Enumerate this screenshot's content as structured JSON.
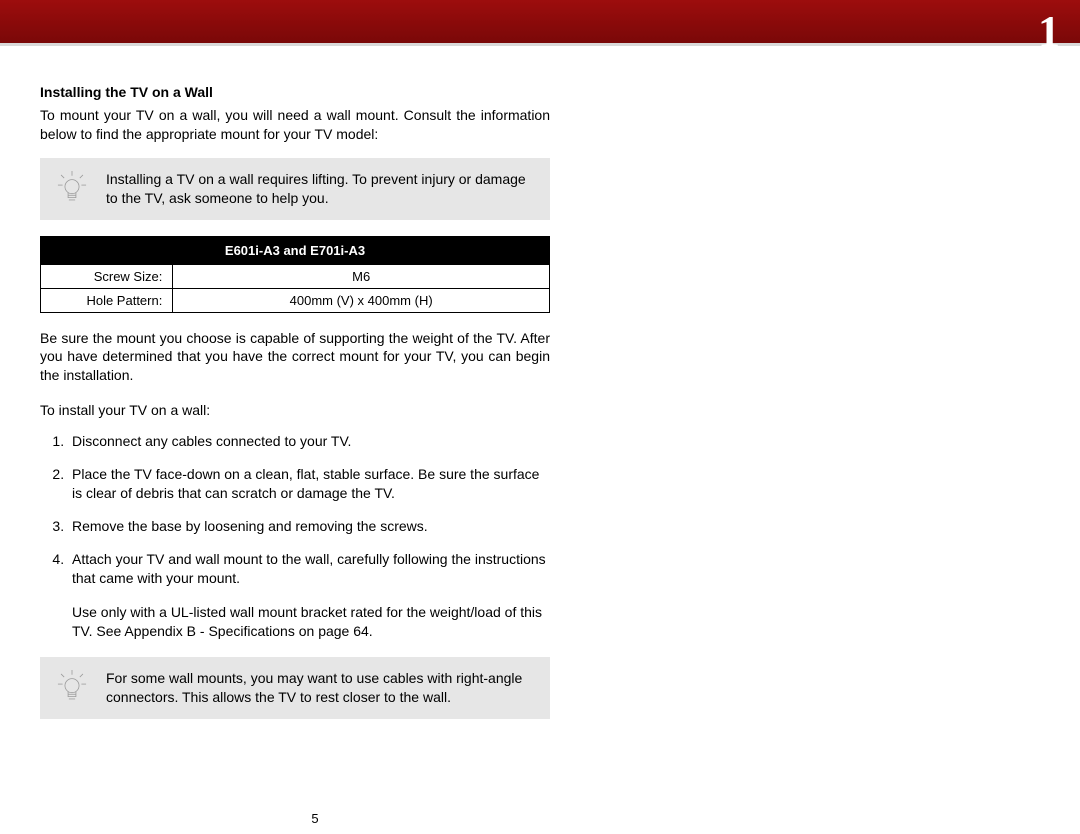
{
  "chapter_number": "1",
  "heading": "Installing the TV on a Wall",
  "intro": "To mount your TV on a wall, you will need a wall mount. Consult the information below to find the appropriate mount for your TV model:",
  "tip1": "Installing a TV on a wall requires lifting. To prevent injury or damage to the TV, ask someone to help you.",
  "table": {
    "header": "E601i-A3 and E701i-A3",
    "rows": [
      {
        "label": "Screw Size:",
        "value": "M6"
      },
      {
        "label": "Hole Pattern:",
        "value": "400mm (V) x 400mm (H)"
      }
    ]
  },
  "ensure": "Be sure the mount you choose is capable of supporting the weight of the TV. After you have determined that you have the correct mount for your TV, you can begin the installation.",
  "lead": "To install your TV on a wall:",
  "steps": [
    "Disconnect any cables connected to your TV.",
    "Place the TV face-down on a clean, flat, stable surface. Be sure the surface is clear of debris that can scratch or damage the TV.",
    "Remove the base by loosening and removing the screws.",
    "Attach your TV and wall mount to the wall, carefully following the instructions that came with your mount."
  ],
  "ulnote": "Use only with a UL-listed wall mount bracket rated for the weight/load of this TV. See Appendix B - Specifications on page 64.",
  "tip2": "For some wall mounts, you may want to use cables with right-angle connectors. This allows the TV to rest closer to the wall.",
  "page_number": "5"
}
